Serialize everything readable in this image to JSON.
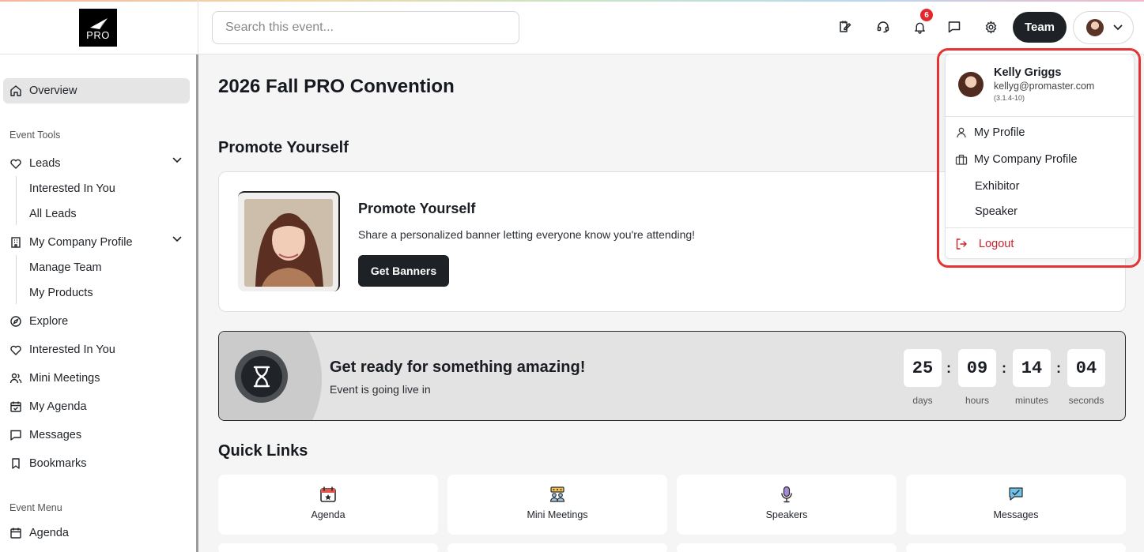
{
  "header": {
    "search_placeholder": "Search this event...",
    "logo_text": "PRO",
    "notification_count": "6",
    "team_label": "Team"
  },
  "sidebar": {
    "overview": "Overview",
    "event_tools_label": "Event Tools",
    "leads": "Leads",
    "leads_sub": [
      "Interested In You",
      "All Leads"
    ],
    "company_profile": "My Company Profile",
    "company_sub": [
      "Manage Team",
      "My Products"
    ],
    "explore": "Explore",
    "interested": "Interested In You",
    "mini_meetings": "Mini Meetings",
    "my_agenda": "My Agenda",
    "messages": "Messages",
    "bookmarks": "Bookmarks",
    "event_menu_label": "Event Menu",
    "agenda": "Agenda"
  },
  "main": {
    "title": "2026 Fall PRO Convention",
    "promote_section": "Promote Yourself",
    "promote_title": "Promote Yourself",
    "promote_text": "Share a personalized banner letting everyone know you're attending!",
    "promote_button": "Get Banners",
    "countdown_title": "Get ready for something amazing!",
    "countdown_sub": "Event is going live in",
    "countdown": [
      {
        "value": "25",
        "label": "days"
      },
      {
        "value": "09",
        "label": "hours"
      },
      {
        "value": "14",
        "label": "minutes"
      },
      {
        "value": "04",
        "label": "seconds"
      }
    ],
    "quick_links_title": "Quick Links",
    "quick_links": [
      "Agenda",
      "Mini Meetings",
      "Speakers",
      "Messages"
    ]
  },
  "user_menu": {
    "name": "Kelly Griggs",
    "email": "kellyg@promaster.com",
    "version": "(3.1.4-10)",
    "items": [
      "My Profile",
      "My Company Profile",
      "Exhibitor",
      "Speaker"
    ],
    "logout": "Logout"
  },
  "colors": {
    "accent_dark": "#1e2126",
    "highlight_red": "#e53232",
    "logout_red": "#c8232b"
  }
}
